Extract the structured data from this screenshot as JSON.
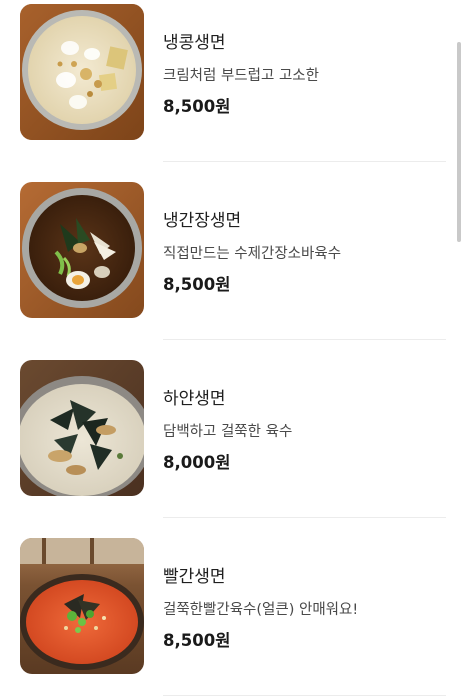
{
  "menu": {
    "items": [
      {
        "name": "냉콩생면",
        "description": "크림처럼 부드럽고 고소한",
        "price": "8,500원"
      },
      {
        "name": "냉간장생면",
        "description": "직접만드는 수제간장소바육수",
        "price": "8,500원"
      },
      {
        "name": "하얀생면",
        "description": "담백하고 걸쭉한 육수",
        "price": "8,000원"
      },
      {
        "name": "빨간생면",
        "description": "걸쭉한빨간육수(얼큰) 안매워요!",
        "price": "8,500원"
      }
    ]
  },
  "colors": {
    "background": "#ffffff",
    "divider": "#ececec",
    "text_primary": "#1f1f1f",
    "text_secondary": "#4a4a4a",
    "scrollbar": "#c9c9c9"
  }
}
